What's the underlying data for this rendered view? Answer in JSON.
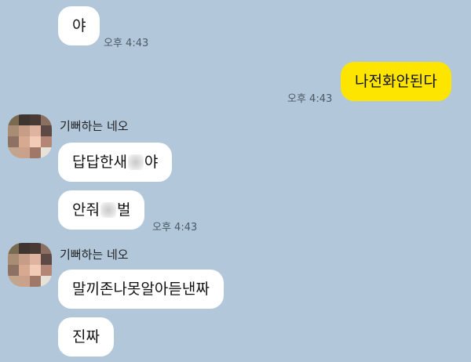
{
  "colors": {
    "chat_background": "#b2c7d9",
    "received_bubble": "#ffffff",
    "sent_bubble": "#fee500"
  },
  "messages": {
    "m1": {
      "text": "야",
      "time": "오후 4:43"
    },
    "m2": {
      "text": "나전화안된다",
      "time": "오후 4:43"
    },
    "group1": {
      "sender": "기뻐하는 네오",
      "m3": {
        "before": "답답한새",
        "after": "야"
      },
      "m4": {
        "before": "안줘",
        "after": "벌",
        "time": "오후 4:43"
      }
    },
    "group2": {
      "sender": "기뻐하는 네오",
      "m5": {
        "text": "말끼존나못알아듣낸짜"
      },
      "m6": {
        "text": "진짜"
      }
    }
  }
}
